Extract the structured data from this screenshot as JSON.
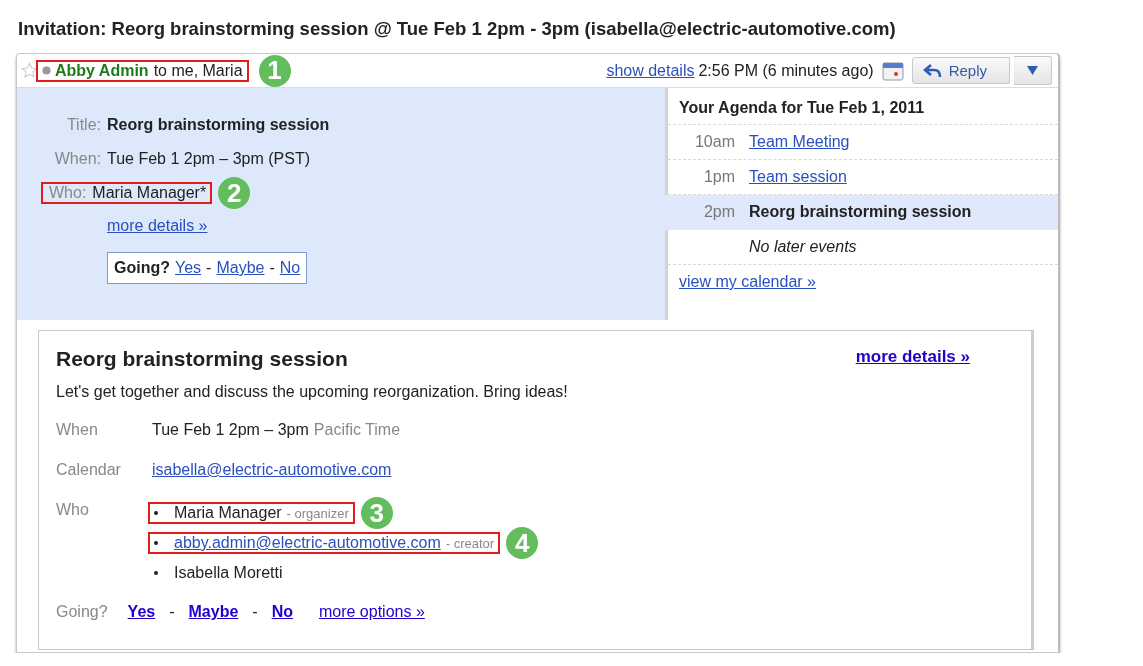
{
  "subject": "Invitation: Reorg brainstorming session @ Tue Feb 1 2pm - 3pm (isabella@electric-automotive.com)",
  "header": {
    "starred": false,
    "sender": "Abby Admin",
    "recipients": "to me, Maria",
    "show_details": "show details",
    "time": "2:56 PM (6 minutes ago)",
    "reply": "Reply",
    "highlighted": true,
    "callout": "1"
  },
  "summary": {
    "rows": [
      {
        "label": "Title:",
        "value": "Reorg brainstorming session",
        "kind": "title",
        "highlighted": false
      },
      {
        "label": "When:",
        "value": "Tue Feb 1 2pm – 3pm (PST)",
        "kind": "plain",
        "highlighted": false
      },
      {
        "label": "Who:",
        "value": "Maria Manager*",
        "kind": "plain",
        "highlighted": true,
        "callout": "2"
      }
    ],
    "more_details": "more details »",
    "rsvp": {
      "question": "Going?",
      "options": [
        "Yes",
        "Maybe",
        "No"
      ],
      "separator": "-"
    }
  },
  "agenda": {
    "heading": "Your Agenda for Tue Feb 1, 2011",
    "events": [
      {
        "time": "10am",
        "title": "Team Meeting",
        "selected": false
      },
      {
        "time": "1pm",
        "title": "Team session",
        "selected": false
      },
      {
        "time": "2pm",
        "title": "Reorg brainstorming session",
        "selected": true
      }
    ],
    "note": "No later events",
    "link": "view my calendar »"
  },
  "card": {
    "title": "Reorg brainstorming session",
    "more_details": "more details »",
    "description": "Let's get together and discuss the upcoming reorganization. Bring ideas!",
    "when_label": "When",
    "when": "Tue Feb 1 2pm – 3pm",
    "timezone": "Pacific Time",
    "calendar_label": "Calendar",
    "calendar": "isabella@electric-automotive.com",
    "who_label": "Who",
    "guests": [
      {
        "name": "Maria Manager",
        "is_link": false,
        "role": "- organizer",
        "highlighted": true,
        "callout": "3"
      },
      {
        "name": "abby.admin@electric-automotive.com",
        "is_link": true,
        "role": "- creator",
        "highlighted": true,
        "callout": "4"
      },
      {
        "name": "Isabella Moretti",
        "is_link": false,
        "highlighted": false
      }
    ],
    "going_label": "Going?",
    "options": [
      "Yes",
      "Maybe",
      "No"
    ],
    "separator": "-",
    "more_options": "more options »"
  }
}
